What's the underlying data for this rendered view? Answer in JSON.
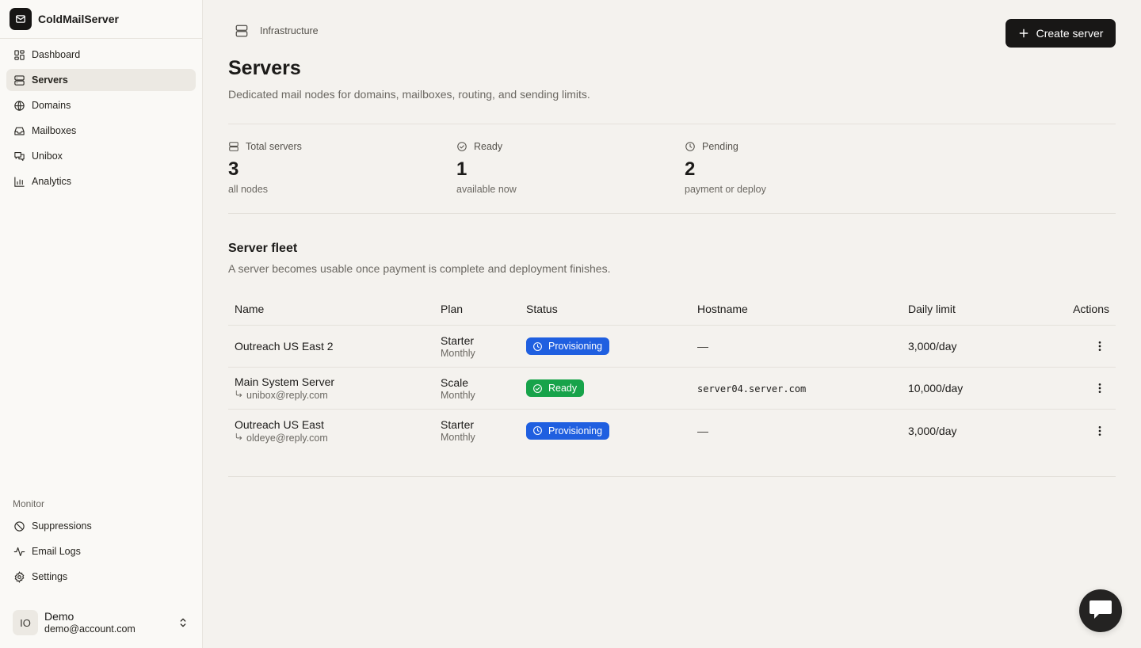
{
  "brand": {
    "name": "ColdMailServer"
  },
  "sidebar": {
    "items": [
      {
        "label": "Dashboard",
        "icon": "dashboard-icon"
      },
      {
        "label": "Servers",
        "icon": "server-icon",
        "active": true
      },
      {
        "label": "Domains",
        "icon": "globe-icon"
      },
      {
        "label": "Mailboxes",
        "icon": "inbox-icon"
      },
      {
        "label": "Unibox",
        "icon": "chat-icon"
      },
      {
        "label": "Analytics",
        "icon": "chart-icon"
      }
    ],
    "monitor_label": "Monitor",
    "monitor_items": [
      {
        "label": "Suppressions",
        "icon": "ban-icon"
      },
      {
        "label": "Email Logs",
        "icon": "activity-icon"
      },
      {
        "label": "Settings",
        "icon": "gear-icon"
      }
    ]
  },
  "user": {
    "initials": "IO",
    "name": "Demo",
    "email": "demo@account.com"
  },
  "header": {
    "breadcrumb": "Infrastructure",
    "create_label": "Create server",
    "title": "Servers",
    "subtitle": "Dedicated mail nodes for domains, mailboxes, routing, and sending limits."
  },
  "stats": [
    {
      "label": "Total servers",
      "value": "3",
      "sub": "all nodes",
      "icon": "server-icon"
    },
    {
      "label": "Ready",
      "value": "1",
      "sub": "available now",
      "icon": "check-circle-icon"
    },
    {
      "label": "Pending",
      "value": "2",
      "sub": "payment or deploy",
      "icon": "clock-icon"
    }
  ],
  "fleet": {
    "title": "Server fleet",
    "subtitle": "A server becomes usable once payment is complete and deployment finishes.",
    "columns": [
      "Name",
      "Plan",
      "Status",
      "Hostname",
      "Daily limit",
      "Actions"
    ],
    "rows": [
      {
        "name": "Outreach US East 2",
        "sub": "",
        "plan": "Starter",
        "billing": "Monthly",
        "status": "Provisioning",
        "hostname": "—",
        "limit": "3,000/day"
      },
      {
        "name": "Main System Server",
        "sub": "unibox@reply.com",
        "plan": "Scale",
        "billing": "Monthly",
        "status": "Ready",
        "hostname": "server04.server.com",
        "limit": "10,000/day"
      },
      {
        "name": "Outreach US East",
        "sub": "oldeye@reply.com",
        "plan": "Starter",
        "billing": "Monthly",
        "status": "Provisioning",
        "hostname": "—",
        "limit": "3,000/day"
      }
    ]
  },
  "colors": {
    "provisioning": "#1f5fe0",
    "ready": "#17a34a",
    "primary": "#181716"
  }
}
